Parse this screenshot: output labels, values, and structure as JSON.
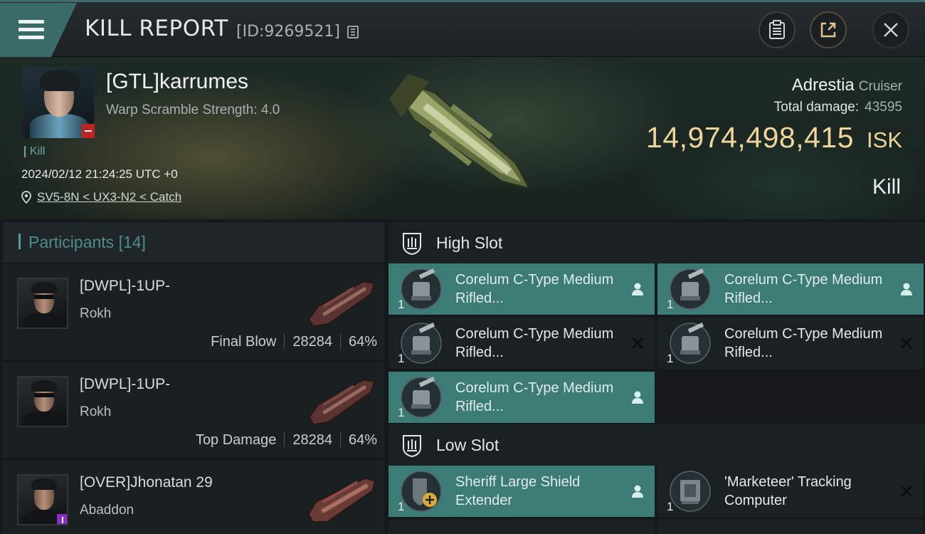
{
  "header": {
    "title": "KILL REPORT",
    "report_id": "[ID:9269521]"
  },
  "victim": {
    "name": "[GTL]karrumes",
    "warp_info": "Warp Scramble Strength: 4.0",
    "kill_tag": "Kill",
    "datetime": "2024/02/12 21:24:25 UTC +0",
    "location": "SV5-8N < UX3-N2 < Catch",
    "ship_name": "Adrestia",
    "ship_class": "Cruiser",
    "total_damage_label": "Total damage:",
    "total_damage_value": "43595",
    "isk_value": "14,974,498,415",
    "isk_unit": "ISK",
    "result": "Kill"
  },
  "participants": {
    "label": "Participants",
    "count": "[14]",
    "items": [
      {
        "name": "[DWPL]-1UP-",
        "ship": "Rokh",
        "role": "Final Blow",
        "damage": "28284",
        "percent": "64%"
      },
      {
        "name": "[DWPL]-1UP-",
        "ship": "Rokh",
        "role": "Top Damage",
        "damage": "28284",
        "percent": "64%"
      },
      {
        "name": "[OVER]Jhonatan 29",
        "ship": "Abaddon",
        "role": "",
        "damage": "",
        "percent": ""
      }
    ]
  },
  "slots": {
    "high": {
      "title": "High Slot",
      "modules": [
        {
          "name": "Corelum C-Type Medium Rifled...",
          "qty": "1",
          "status": "dropped"
        },
        {
          "name": "Corelum C-Type Medium Rifled...",
          "qty": "1",
          "status": "dropped"
        },
        {
          "name": "Corelum C-Type Medium Rifled...",
          "qty": "1",
          "status": "destroyed"
        },
        {
          "name": "Corelum C-Type Medium Rifled...",
          "qty": "1",
          "status": "destroyed"
        },
        {
          "name": "Corelum C-Type Medium Rifled...",
          "qty": "1",
          "status": "dropped"
        }
      ]
    },
    "low": {
      "title": "Low Slot",
      "modules": [
        {
          "name": "Sheriff Large Shield Extender",
          "qty": "1",
          "status": "dropped"
        },
        {
          "name": "'Marketeer' Tracking Computer",
          "qty": "1",
          "status": "destroyed"
        }
      ]
    }
  },
  "colors": {
    "accent": "#3d7c76",
    "isk": "#f0d59a",
    "participants_label": "#4e8e88",
    "loss_badge": "#c02324"
  },
  "icons": [
    "menu-icon",
    "copy-icon",
    "clipboard-icon",
    "share-icon",
    "close-icon",
    "location-pin-icon",
    "high-slot-icon",
    "low-slot-icon",
    "dropped-person-icon",
    "destroyed-x-icon"
  ]
}
